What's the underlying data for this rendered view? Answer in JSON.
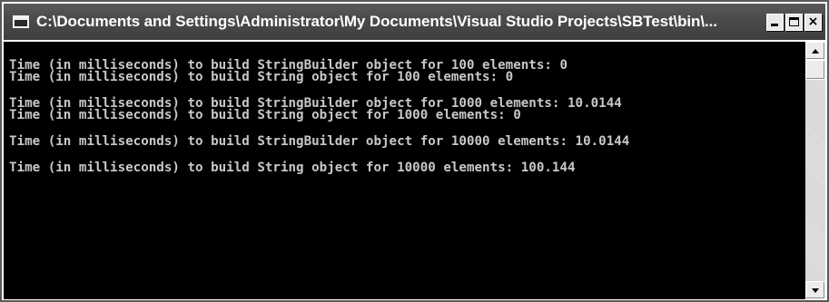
{
  "window": {
    "title": "C:\\Documents and Settings\\Administrator\\My Documents\\Visual Studio Projects\\SBTest\\bin\\...",
    "buttons": {
      "minimize": "_",
      "maximize": "□",
      "close": "×"
    }
  },
  "console": {
    "lines": [
      "Time (in milliseconds) to build StringBuilder object for 100 elements: 0",
      "Time (in milliseconds) to build String object for 100 elements: 0",
      "",
      "Time (in milliseconds) to build StringBuilder object for 1000 elements: 10.0144",
      "Time (in milliseconds) to build String object for 1000 elements: 0",
      "",
      "Time (in milliseconds) to build StringBuilder object for 10000 elements: 10.0144",
      "",
      "Time (in milliseconds) to build String object for 10000 elements: 100.144"
    ]
  },
  "colors": {
    "console_bg": "#000000",
    "console_text": "#c8c8c8",
    "titlebar": "#4b4b4b"
  }
}
